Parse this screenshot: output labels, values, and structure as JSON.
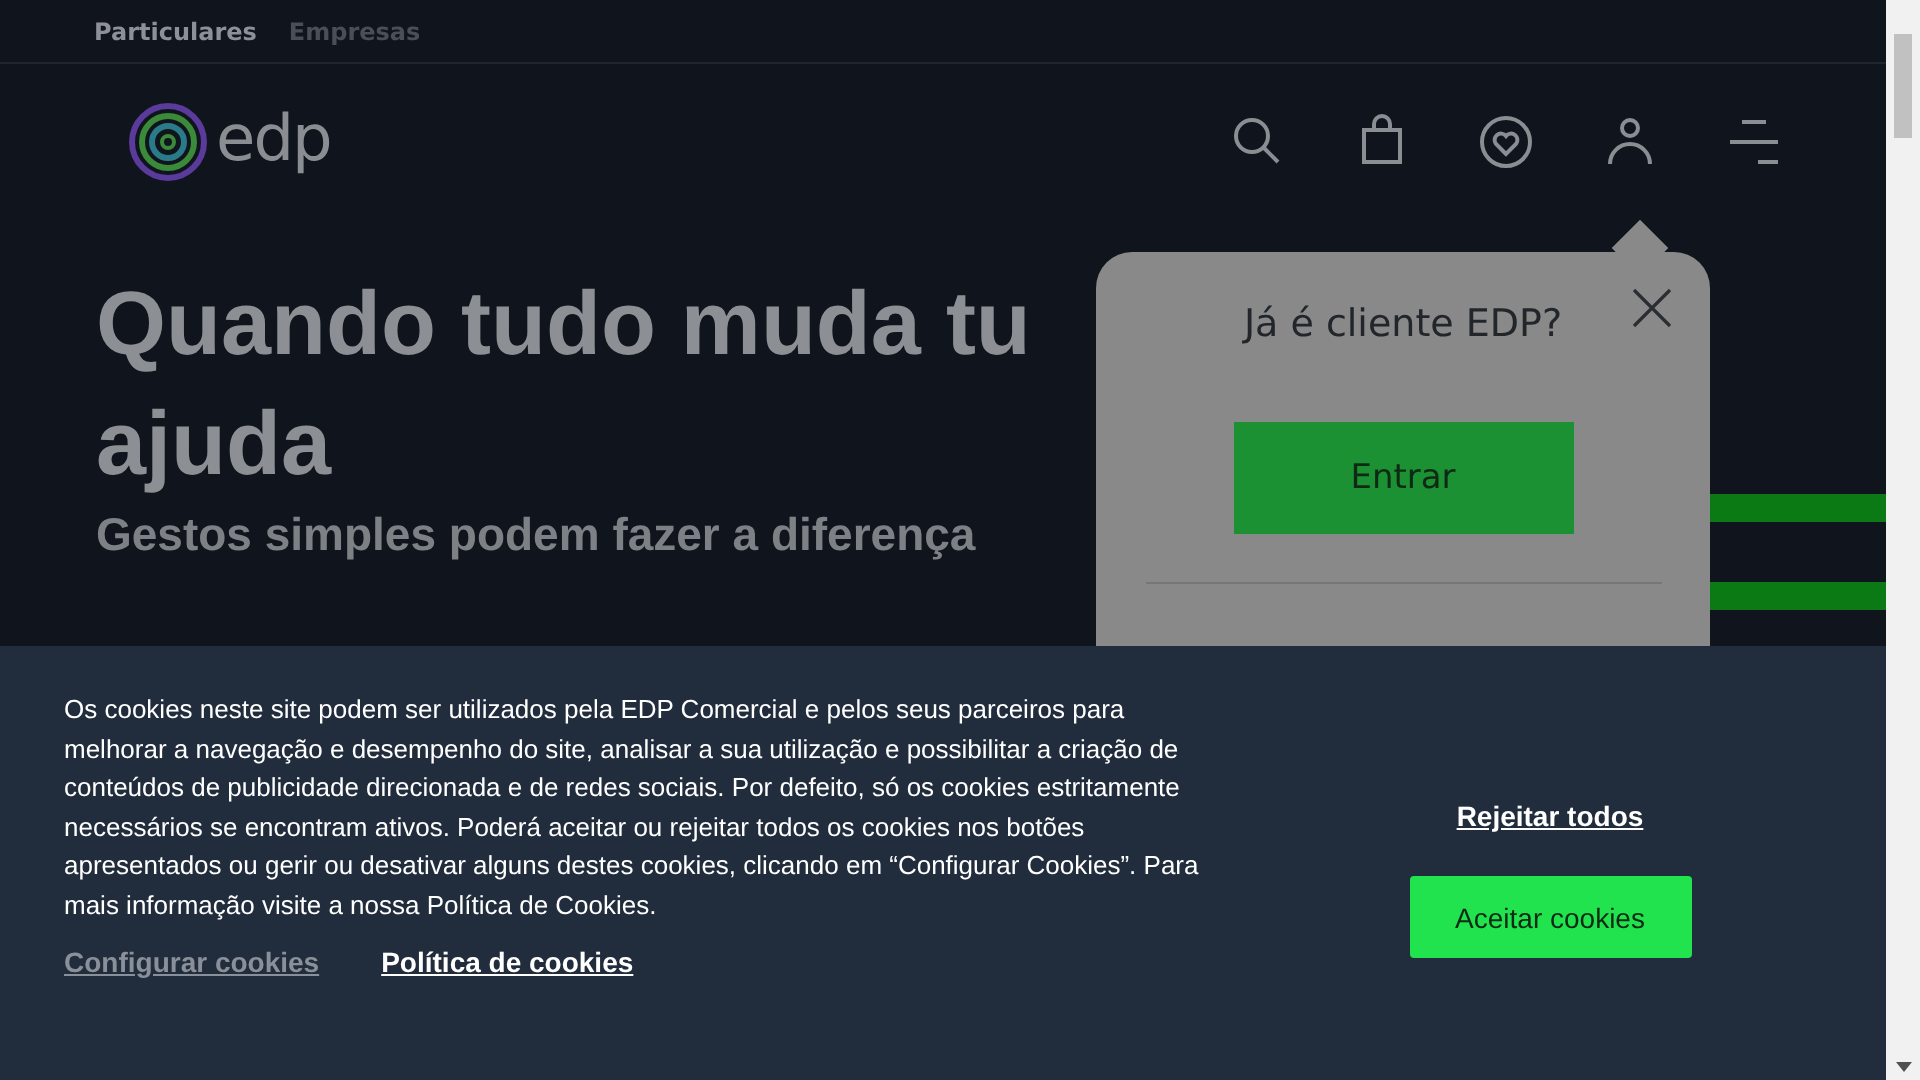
{
  "segments": [
    {
      "label": "Particulares",
      "selected": true
    },
    {
      "label": "Empresas",
      "selected": false
    }
  ],
  "header": {
    "logo": "edp"
  },
  "hero": {
    "title": "Quando tudo muda tu",
    "title_line2": "ajuda",
    "subtitle": "Gestos simples podem fazer a diferença"
  },
  "login_popup": {
    "title": "Já é cliente EDP?",
    "button": "Entrar"
  },
  "cookie_banner": {
    "text": "Os cookies neste site podem ser utilizados pela EDP Comercial e pelos seus parceiros para melhorar a navegação e desempenho do site, analisar a sua utilização e possibilitar a criação de conteúdos de publicidade direcionada e de redes sociais. Por defeito, só os cookies estritamente necessários se encontram ativos. Poderá aceitar ou rejeitar todos os cookies nos botões apresentados ou gerir ou desativar alguns destes cookies, clicando em “Configurar Cookies”. Para mais informação visite a nossa Política de Cookies.",
    "links": [
      "Configurar cookies",
      "Política de cookies"
    ],
    "reject": "Rejeitar todos",
    "accept": "Aceitar cookies"
  }
}
